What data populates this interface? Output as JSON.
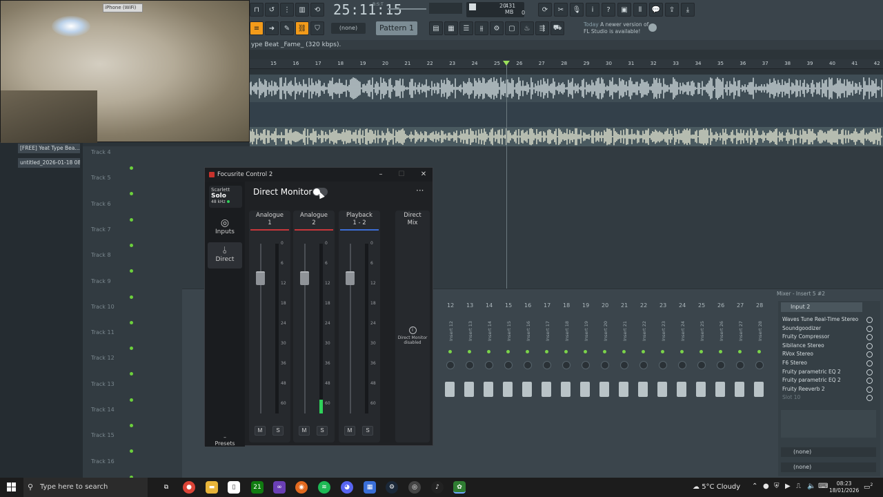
{
  "webcam": {
    "label": "iPhone (WiFi)"
  },
  "fl_toolbar": {
    "time": "25:11:15",
    "time_sub": "B:S:T",
    "cpu": "20",
    "mem": "431 MB",
    "mem2": "0",
    "mode_select": "(none)",
    "pattern": "Pattern 1",
    "update_notice_day": "Today",
    "update_notice_text": "A newer version of",
    "update_notice_text2": "FL Studio is available!"
  },
  "playlist": {
    "song_title": "ype Beat _Fame_ (320 kbps).",
    "ticks": [
      "15",
      "16",
      "17",
      "18",
      "19",
      "20",
      "21",
      "22",
      "23",
      "24",
      "25",
      "26",
      "27",
      "28",
      "29",
      "30",
      "31",
      "32",
      "33",
      "34",
      "35",
      "36",
      "37",
      "38",
      "39",
      "40",
      "41",
      "42"
    ],
    "tracks": [
      "Track 4",
      "Track 5",
      "Track 6",
      "Track 7",
      "Track 8",
      "Track 9",
      "Track 10",
      "Track 11",
      "Track 12",
      "Track 13",
      "Track 14",
      "Track 15",
      "Track 16"
    ]
  },
  "browser": {
    "items": [
      "[FREE] Yeat Type Bea...",
      "untitled_2026-01-18 08-..."
    ]
  },
  "mixer": {
    "title": "Mixer - Insert 5 #2",
    "insert_numbers": [
      "12",
      "13",
      "14",
      "15",
      "16",
      "17",
      "18",
      "19",
      "20",
      "21",
      "22",
      "23",
      "24",
      "25",
      "26",
      "27",
      "28"
    ],
    "insert_labels": [
      "Insert 12",
      "Insert 13",
      "Insert 14",
      "Insert 15",
      "Insert 16",
      "Insert 17",
      "Insert 18",
      "Insert 19",
      "Insert 20",
      "Insert 21",
      "Insert 22",
      "Insert 23",
      "Insert 24",
      "Insert 25",
      "Insert 26",
      "Insert 27",
      "Insert 28"
    ],
    "input": "Input 2",
    "fx_slots": [
      "Waves Tune Real-Time Stereo",
      "Soundgoodizer",
      "Fruity Compressor",
      "Sibilance Stereo",
      "RVox Stereo",
      "F6 Stereo",
      "Fruity parametric EQ 2",
      "Fruity parametric EQ 2",
      "Fruity Reeverb 2",
      "Slot 10"
    ],
    "out_none_1": "(none)",
    "out_none_2": "(none)"
  },
  "focusrite": {
    "title": "Focusrite Control 2",
    "device_brand": "Scarlett",
    "device_model": "Solo",
    "sample_rate": "48 kHz",
    "nav_inputs": "Inputs",
    "nav_direct": "Direct",
    "presets": "Presets",
    "direct_monitor_label": "Direct Monitor",
    "direct_monitor_on": false,
    "more": "···",
    "channels": [
      {
        "name1": "Analogue",
        "name2": "1",
        "line_color": "#c8373b",
        "level": 0.0
      },
      {
        "name1": "Analogue",
        "name2": "2",
        "line_color": "#c8373b",
        "level": 0.08
      },
      {
        "name1": "Playback",
        "name2": "1 - 2",
        "line_color": "#3d6fd6",
        "level": 0.0
      }
    ],
    "scale": [
      "0",
      "6",
      "12",
      "18",
      "24",
      "30",
      "36",
      "48",
      "60"
    ],
    "mute": "M",
    "solo": "S",
    "direct_mix_1": "Direct",
    "direct_mix_2": "Mix",
    "dm_disabled_1": "Direct Monitor",
    "dm_disabled_2": "disabled",
    "info_icon": "i"
  },
  "taskbar": {
    "search_placeholder": "Type here to search",
    "weather": "5°C  Cloudy",
    "time": "08:23",
    "date": "18/01/2026",
    "xbox_badge": "21",
    "notifications": "2"
  }
}
